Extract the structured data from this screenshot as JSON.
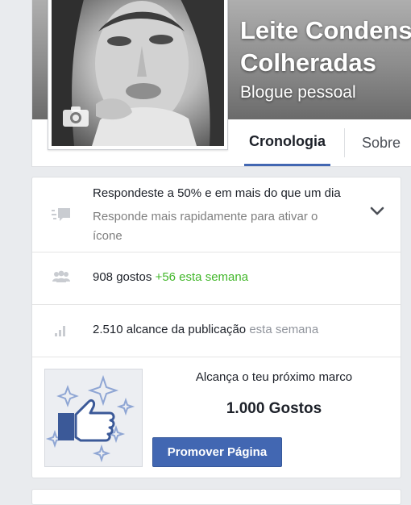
{
  "page": {
    "name_line1": "Leite Condensado",
    "name_line2": "Colheradas",
    "category": "Blogue pessoal"
  },
  "tabs": [
    {
      "label": "Cronologia",
      "active": true
    },
    {
      "label": "Sobre",
      "active": false
    }
  ],
  "response": {
    "title": "Respondeste a 50% e em mais do que um dia",
    "subtitle": "Responde mais rapidamente para ativar o ícone",
    "icon": "message-bubble-icon"
  },
  "likes": {
    "count": "908 gostos",
    "delta": "+56 esta semana",
    "icon": "people-icon"
  },
  "reach": {
    "count": "2.510 alcance da publicação",
    "period": "esta semana",
    "icon": "bar-chart-icon"
  },
  "milestone": {
    "heading": "Alcança o teu próximo marco",
    "target": "1.000 Gostos",
    "button_label": "Promover Página",
    "icon": "thumbs-up-icon"
  },
  "colors": {
    "accent": "#4267b2",
    "green": "#42b72a",
    "muted": "#90949c"
  }
}
